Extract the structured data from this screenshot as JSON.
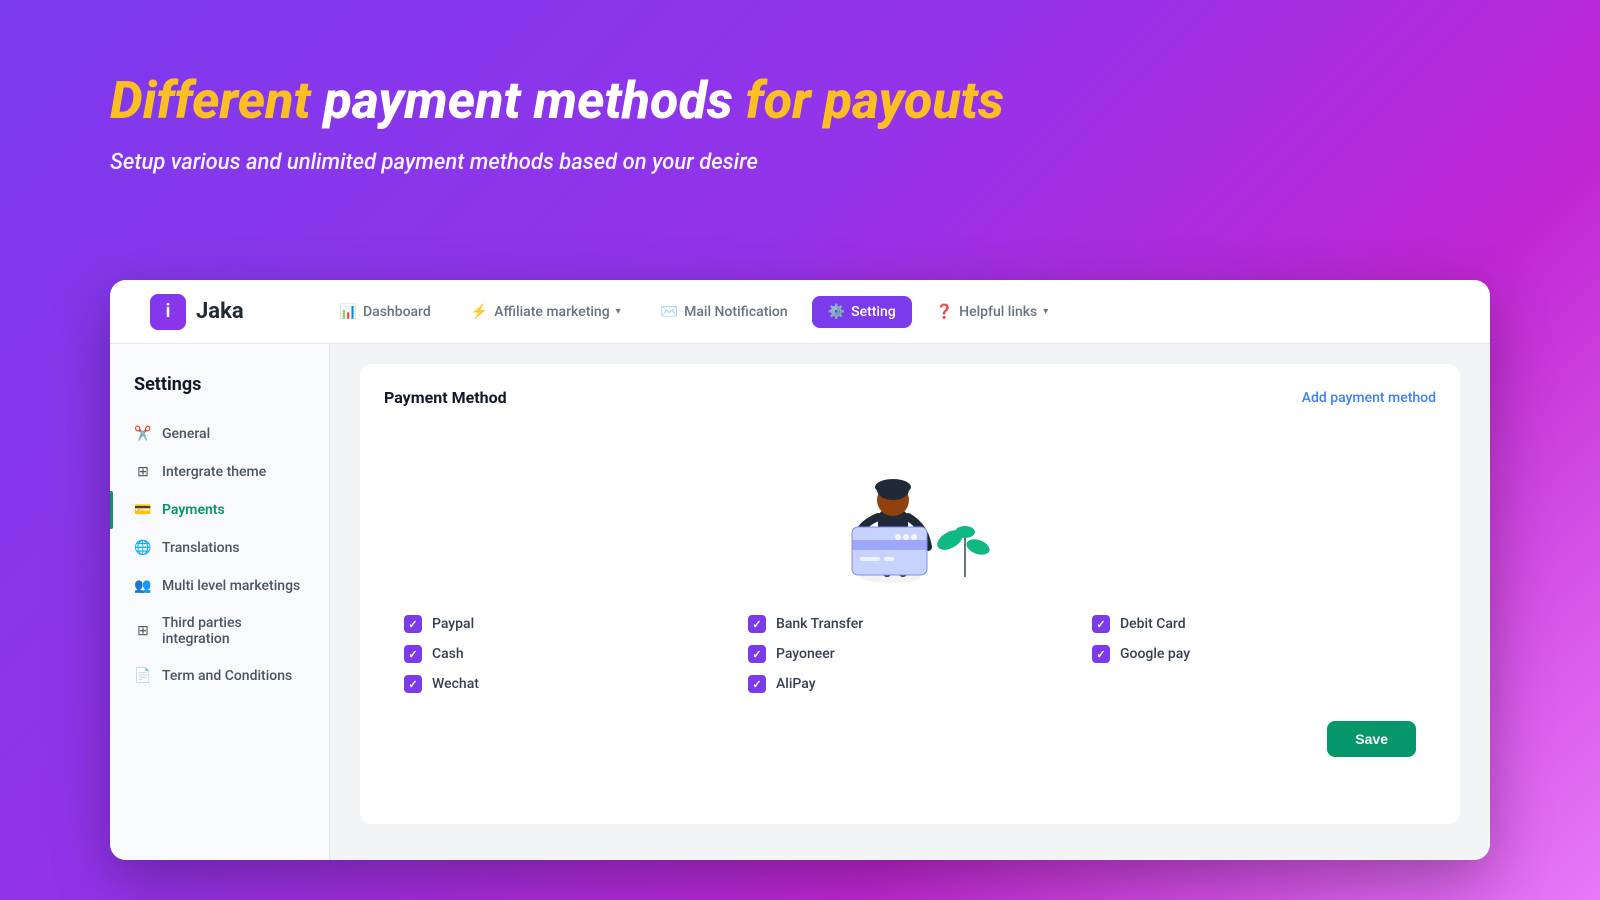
{
  "hero": {
    "title_part1": "Different",
    "title_part2": "payment methods",
    "title_part3": "for payouts",
    "subtitle": "Setup various and unlimited payment methods based on your desire"
  },
  "navbar": {
    "logo_text": "Jaka",
    "logo_icon": "i",
    "items": [
      {
        "id": "dashboard",
        "label": "Dashboard",
        "icon": "📊",
        "active": false
      },
      {
        "id": "affiliate",
        "label": "Affiliate marketing",
        "icon": "⚡",
        "active": false,
        "has_chevron": true
      },
      {
        "id": "mail",
        "label": "Mail Notification",
        "icon": "✉️",
        "active": false
      },
      {
        "id": "setting",
        "label": "Setting",
        "icon": "⚙️",
        "active": true
      },
      {
        "id": "helpful",
        "label": "Helpful links",
        "icon": "❓",
        "active": false,
        "has_chevron": true
      }
    ]
  },
  "settings": {
    "title": "Settings",
    "menu": [
      {
        "id": "general",
        "label": "General",
        "icon": "✂️",
        "active": false
      },
      {
        "id": "integrate",
        "label": "Intergrate theme",
        "icon": "⊞",
        "active": false
      },
      {
        "id": "payments",
        "label": "Payments",
        "icon": "💳",
        "active": true
      },
      {
        "id": "translations",
        "label": "Translations",
        "icon": "🌐",
        "active": false
      },
      {
        "id": "multilevel",
        "label": "Multi level marketings",
        "icon": "👥",
        "active": false
      },
      {
        "id": "thirdparty",
        "label": "Third parties integration",
        "icon": "⊞",
        "active": false
      },
      {
        "id": "terms",
        "label": "Term and Conditions",
        "icon": "📄",
        "active": false
      }
    ]
  },
  "payment_method": {
    "title": "Payment Method",
    "add_link": "Add payment method",
    "options": [
      {
        "id": "paypal",
        "label": "Paypal",
        "checked": true
      },
      {
        "id": "bank_transfer",
        "label": "Bank Transfer",
        "checked": true
      },
      {
        "id": "debit_card",
        "label": "Debit Card",
        "checked": true
      },
      {
        "id": "cash",
        "label": "Cash",
        "checked": true
      },
      {
        "id": "payoneer",
        "label": "Payoneer",
        "checked": true
      },
      {
        "id": "google_pay",
        "label": "Google pay",
        "checked": true
      },
      {
        "id": "wechat",
        "label": "Wechat",
        "checked": true
      },
      {
        "id": "alipay",
        "label": "AliPay",
        "checked": true
      }
    ],
    "save_label": "Save"
  }
}
